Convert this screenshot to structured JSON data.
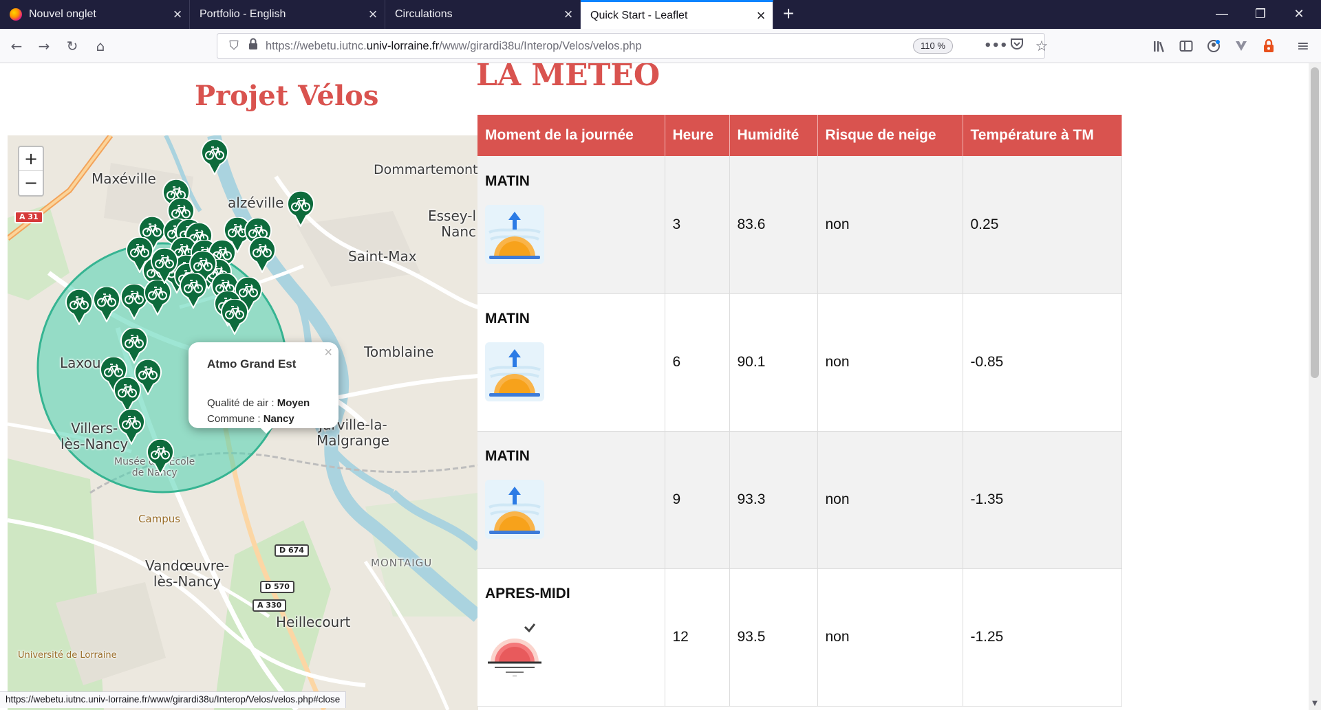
{
  "browser": {
    "tabs": [
      {
        "label": "Nouvel onglet",
        "active": false
      },
      {
        "label": "Portfolio - English",
        "active": false
      },
      {
        "label": "Circulations",
        "active": false
      },
      {
        "label": "Quick Start - Leaflet",
        "active": true
      }
    ],
    "url_prefix": "https://webetu.iutnc.",
    "url_domain": "univ-lorraine.fr",
    "url_path": "/www/girardi38u/Interop/Velos/velos.php",
    "zoom": "110 %",
    "status_url": "https://webetu.iutnc.univ-lorraine.fr/www/girardi38u/Interop/Velos/velos.php#close"
  },
  "page": {
    "title_velos": "Projet Vélos",
    "title_meteo": "LA METEO"
  },
  "map": {
    "zoom_in": "+",
    "zoom_out": "−",
    "places": {
      "maxeville": "Maxéville",
      "malzeville": "alzéville",
      "dommartemont": "Dommartemont",
      "essey": "Essey-l",
      "essey2": "Nanc",
      "saint_max": "Saint-Max",
      "tomblaine": "Tomblaine",
      "laxou": "Laxou",
      "villers": "Villers-",
      "villers2": "lès-Nancy",
      "jarville": "Jarville-la-",
      "jarville2": "Malgrange",
      "vandoeuvre": "Vandœuvre-",
      "vandoeuvre2": "lès-Nancy",
      "heillecourt": "Heillecourt",
      "montaigu": "MONTAIGU",
      "musee": "Musée de l'École",
      "musee2": "de Nancy",
      "campus": "Campus",
      "universite": "Université de Lorraine"
    },
    "roads": {
      "a31": "A 31",
      "d674": "D 674",
      "d570": "D 570",
      "a330": "A 330"
    },
    "popup": {
      "close": "×",
      "title": "Atmo Grand Est",
      "air_label": "Qualité de air : ",
      "air_value": "Moyen",
      "commune_label": "Commune : ",
      "commune_value": "Nancy"
    },
    "bike_station_count": 38,
    "colors": {
      "marker": "#0d6b3c",
      "circle": "#4fd1b0",
      "water": "#aad3df"
    }
  },
  "meteo": {
    "headers": [
      "Moment de la journée",
      "Heure",
      "Humidité",
      "Risque de neige",
      "Température à TM"
    ],
    "rows": [
      {
        "moment": "MATIN",
        "icon": "sunrise-icon",
        "heure": "3",
        "humidite": "83.6",
        "neige": "non",
        "temperature": "0.25"
      },
      {
        "moment": "MATIN",
        "icon": "sunrise-icon",
        "heure": "6",
        "humidite": "90.1",
        "neige": "non",
        "temperature": "-0.85"
      },
      {
        "moment": "MATIN",
        "icon": "sunrise-icon",
        "heure": "9",
        "humidite": "93.3",
        "neige": "non",
        "temperature": "-1.35"
      },
      {
        "moment": "APRES-MIDI",
        "icon": "sunset-icon",
        "heure": "12",
        "humidite": "93.5",
        "neige": "non",
        "temperature": "-1.25"
      }
    ],
    "colors": {
      "header": "#d9534f",
      "title": "#d9534f"
    }
  }
}
